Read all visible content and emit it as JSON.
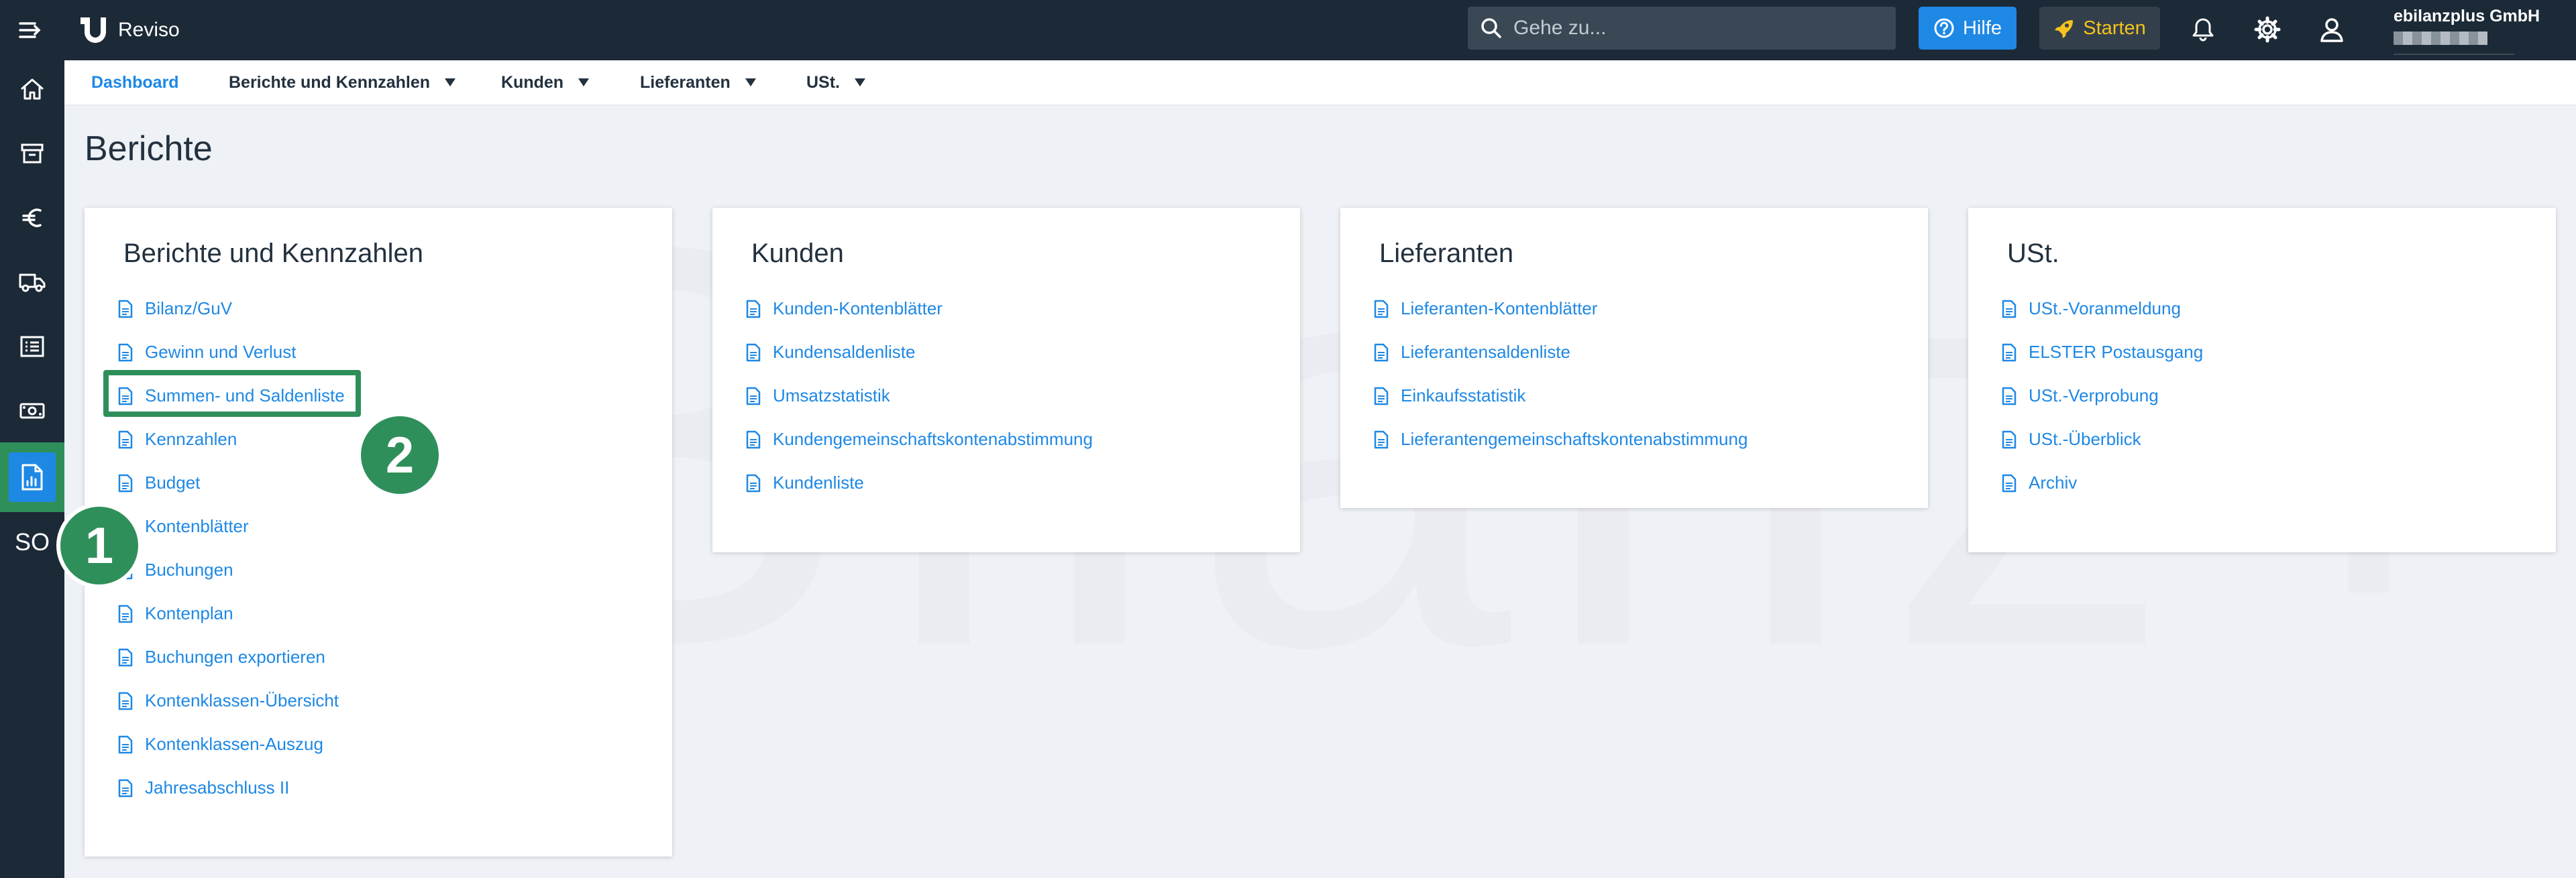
{
  "app": {
    "brand_name": "Reviso"
  },
  "topbar": {
    "search_placeholder": "Gehe zu...",
    "help_label": "Hilfe",
    "start_label": "Starten",
    "company_name": "ebilanzplus GmbH",
    "colors": {
      "bar": "#1c2a37",
      "help": "#1e88e5",
      "start_text": "#f6c21c"
    }
  },
  "sidebar": {
    "items": [
      {
        "icon": "home-icon"
      },
      {
        "icon": "archive-icon"
      },
      {
        "icon": "euro-icon"
      },
      {
        "icon": "truck-icon"
      },
      {
        "icon": "list-icon"
      },
      {
        "icon": "cash-icon"
      },
      {
        "icon": "reports-icon",
        "active": true
      },
      {
        "label": "SO"
      }
    ]
  },
  "subnav": {
    "items": [
      {
        "label": "Dashboard",
        "active": true
      },
      {
        "label": "Berichte und Kennzahlen"
      },
      {
        "label": "Kunden"
      },
      {
        "label": "Lieferanten"
      },
      {
        "label": "USt."
      }
    ]
  },
  "page": {
    "title": "Berichte"
  },
  "cards": [
    {
      "title": "Berichte und Kennzahlen",
      "items": [
        "Bilanz/GuV",
        "Gewinn und Verlust",
        "Summen- und Saldenliste",
        "Kennzahlen",
        "Budget",
        "Kontenblätter",
        "Buchungen",
        "Kontenplan",
        "Buchungen exportieren",
        "Kontenklassen-Übersicht",
        "Kontenklassen-Auszug",
        "Jahresabschluss II"
      ]
    },
    {
      "title": "Kunden",
      "items": [
        "Kunden-Kontenblätter",
        "Kundensaldenliste",
        "Umsatzstatistik",
        "Kundengemeinschaftskontenabstimmung",
        "Kundenliste"
      ]
    },
    {
      "title": "Lieferanten",
      "items": [
        "Lieferanten-Kontenblätter",
        "Lieferantensaldenliste",
        "Einkaufsstatistik",
        "Lieferantengemeinschaftskontenabstimmung"
      ]
    },
    {
      "title": "USt.",
      "items": [
        "USt.-Voranmeldung",
        "ELSTER Postausgang",
        "USt.-Verprobung",
        "USt.-Überblick",
        "Archiv"
      ]
    }
  ],
  "annotations": {
    "step1": "1",
    "step2": "2",
    "color": "#2f8f5b"
  }
}
